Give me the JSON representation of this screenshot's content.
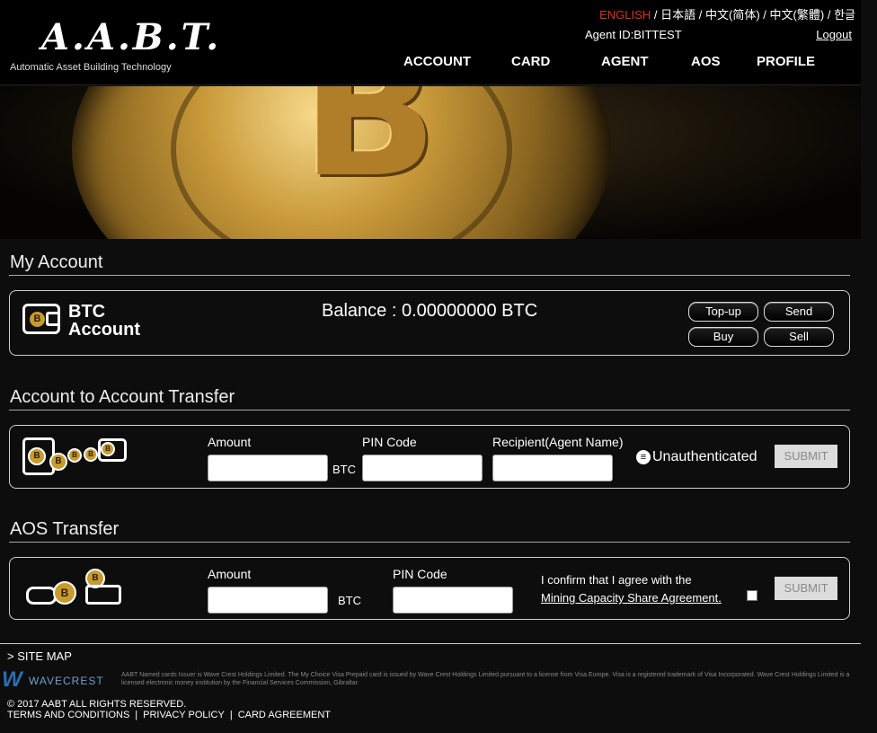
{
  "header": {
    "logo_mark": "A.A.B.T.",
    "logo_sub": "Automatic Asset Building Technology",
    "languages": [
      "ENGLISH",
      "日本語",
      "中文(简体)",
      "中文(繁體)",
      "한글"
    ],
    "lang_sep": "/",
    "agent_id": "Agent ID:BITTEST",
    "logout": "Logout",
    "nav": [
      "ACCOUNT",
      "CARD",
      "AGENT",
      "AOS",
      "PROFILE"
    ]
  },
  "hero": {
    "glyph": "B"
  },
  "my_account": {
    "title": "My Account",
    "account_title_1": "BTC",
    "account_title_2": "Account",
    "coin_glyph": "B",
    "balance": "Balance : 0.00000000 BTC",
    "buttons": {
      "topup": "Top-up",
      "send": "Send",
      "buy": "Buy",
      "sell": "Sell"
    }
  },
  "a2a": {
    "title": "Account to Account Transfer",
    "amount_label": "Amount",
    "unit": "BTC",
    "pin_label": "PIN Code",
    "recipient_label": "Recipient(Agent Name)",
    "status_mark": "≡",
    "status": "Unauthenticated",
    "submit": "SUBMIT"
  },
  "aos": {
    "title": "AOS Transfer",
    "amount_label": "Amount",
    "unit": "BTC",
    "pin_label": "PIN Code",
    "agree_text": "I confirm that I agree with the",
    "agree_link": "Mining Capacity Share Agreement.",
    "submit": "SUBMIT"
  },
  "footer": {
    "sitemap": "> SITE MAP",
    "wc_mark": "W",
    "wc_name": "WAVECREST",
    "legal": "AABT Named cards Issuer is Wave Crest Holdings Limited. The My Choice Visa Prepaid card is issued by Wave Crest Holdings Limited pursuant to a license from Visa Europe. Visa is a registered trademark of Visa Incorporated. Wave Crest Holdings Limited is a licensed electronic money institution by the Financial Services Commission, Gibraltar.",
    "copyright": "© 2017 AABT ALL RIGHTS RESERVED.",
    "links": [
      "TERMS AND CONDITIONS",
      "PRIVACY POLICY",
      "CARD AGREEMENT"
    ],
    "link_sep": "|"
  },
  "colors": {
    "accent_lang": "#e0301e",
    "background": "#0d0d0d",
    "gold": "#c79b2e"
  }
}
